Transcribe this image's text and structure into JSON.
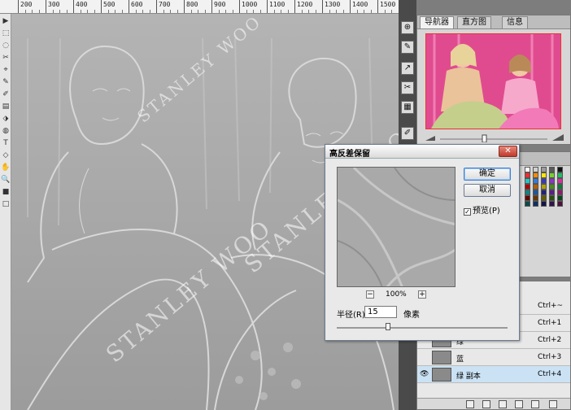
{
  "ruler": {
    "ticks": [
      "200",
      "300",
      "400",
      "500",
      "600",
      "700",
      "800",
      "900",
      "1000",
      "1100",
      "1200",
      "1300",
      "1400",
      "1500",
      "1600"
    ]
  },
  "tools": [
    "▶",
    "⬚",
    "◌",
    "✂",
    "⌖",
    "✎",
    "✐",
    "▤",
    "⬗",
    "◍",
    "T",
    "◇",
    "✋",
    "🔍",
    "■",
    "□"
  ],
  "canvas": {
    "watermarks": [
      "STANLEY WOO",
      "STANLEY WOO",
      "STANLEY WOO"
    ]
  },
  "panelstrip": {
    "icons": [
      "⊕",
      "✎",
      "↗",
      "✂",
      "▦",
      "✐",
      "A",
      "¶"
    ]
  },
  "navigator": {
    "tabs": [
      "导航器",
      "直方图",
      "信息"
    ]
  },
  "swatches": {
    "tabs": [
      "颜色",
      "色板",
      "样式"
    ],
    "colors": [
      "#ffffff",
      "#cfcfcf",
      "#9a9a9a",
      "#5a5a5a",
      "#111111",
      "#ff2a2a",
      "#ff8a00",
      "#ffe600",
      "#78d12b",
      "#1fbf60",
      "#20c7c2",
      "#2f7de0",
      "#3a3ab8",
      "#8b33c9",
      "#d52fa4",
      "#b30000",
      "#b35e00",
      "#b3a100",
      "#4b8c1b",
      "#137a3b",
      "#12847f",
      "#1f55a0",
      "#232378",
      "#5b1f87",
      "#8a1f6b",
      "#660000",
      "#663600",
      "#665c00",
      "#2b500f",
      "#0b4621",
      "#0a4b48",
      "#113060",
      "#141444",
      "#34124d",
      "#4f123d"
    ]
  },
  "layers": {
    "rows": [
      {
        "name": "",
        "key": "Ctrl+~"
      },
      {
        "name": "",
        "key": "Ctrl+1"
      },
      {
        "name": "绿",
        "key": "Ctrl+2"
      },
      {
        "name": "蓝",
        "key": "Ctrl+3"
      },
      {
        "name": "绿 副本",
        "key": "Ctrl+4"
      }
    ]
  },
  "dialog": {
    "title": "高反差保留",
    "ok": "确定",
    "cancel": "取消",
    "preview_label": "预览(P)",
    "zoom": "100%",
    "zoom_minus": "−",
    "zoom_plus": "+",
    "radius_label": "半径(R):",
    "radius_value": "15",
    "radius_unit": "像素",
    "close": "✕"
  }
}
